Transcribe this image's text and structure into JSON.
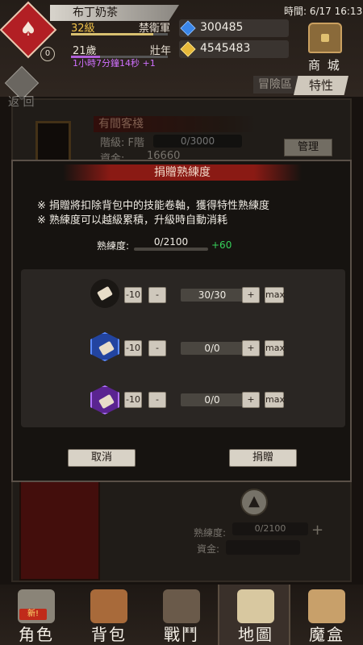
{
  "header": {
    "player_name": "布丁奶茶",
    "level": "32級",
    "rank": "禁衛軍",
    "age": "21歲",
    "age_stage": "壯年",
    "timer": "1小時7分鐘14秒 +1",
    "badge_level": "0",
    "clock": "時間: 6/17 16:13",
    "gems": "300485",
    "gold": "4545483",
    "shop_label": "商 城",
    "back_label": "返 回",
    "tab_adventure": "冒險區",
    "tab_trait": "特性"
  },
  "background": {
    "inn_title": "有間客棧",
    "floor_label": "階級: F階",
    "floor_progress": "0/3000",
    "funds_label": "資金:",
    "funds_value": "16660",
    "manage_button": "管理",
    "skill_label": "熟練度:",
    "skill_progress": "0/2100",
    "skill_plus": "+",
    "funds_label_2": "資金:"
  },
  "dialog": {
    "title": "捐贈熟練度",
    "note_1": "※ 捐贈將扣除背包中的技能卷軸，獲得特性熟練度",
    "note_2": "※ 熟練度可以越級累積，升級時自動消耗",
    "proficiency_label": "熟練度:",
    "proficiency_value": "0/2100",
    "proficiency_gain": "+60",
    "rows": [
      {
        "minus10": "-10",
        "minus": "-",
        "qty": "30/30",
        "plus": "+",
        "max": "max"
      },
      {
        "minus10": "-10",
        "minus": "-",
        "qty": "0/0",
        "plus": "+",
        "max": "max"
      },
      {
        "minus10": "-10",
        "minus": "-",
        "qty": "0/0",
        "plus": "+",
        "max": "max"
      }
    ],
    "cancel": "取消",
    "donate": "捐贈"
  },
  "nav": {
    "items": [
      {
        "label": "角色",
        "badge": "新!"
      },
      {
        "label": "背包"
      },
      {
        "label": "戰鬥"
      },
      {
        "label": "地圖"
      },
      {
        "label": "魔盒"
      }
    ]
  }
}
